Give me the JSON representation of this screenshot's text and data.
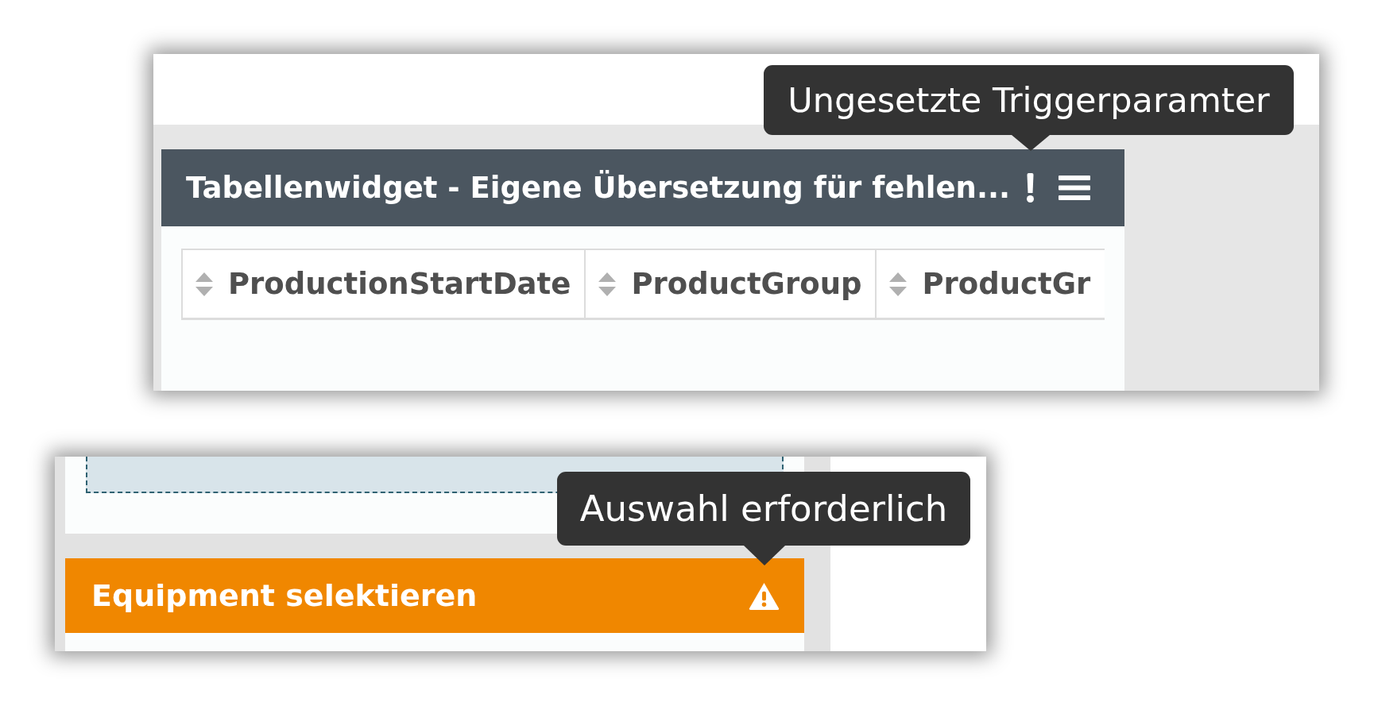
{
  "table_widget": {
    "title": "Tabellenwidget - Eigene Übersetzung für fehlen...",
    "unset_parameters": true,
    "tooltip": "Ungesetzte Triggerparamter",
    "columns": [
      "ProductionStartDate",
      "ProductGroup",
      "ProductGr"
    ]
  },
  "equipment_widget": {
    "title": "Equipment selektieren",
    "selection_required": true,
    "tooltip": "Auswahl erforderlich"
  }
}
